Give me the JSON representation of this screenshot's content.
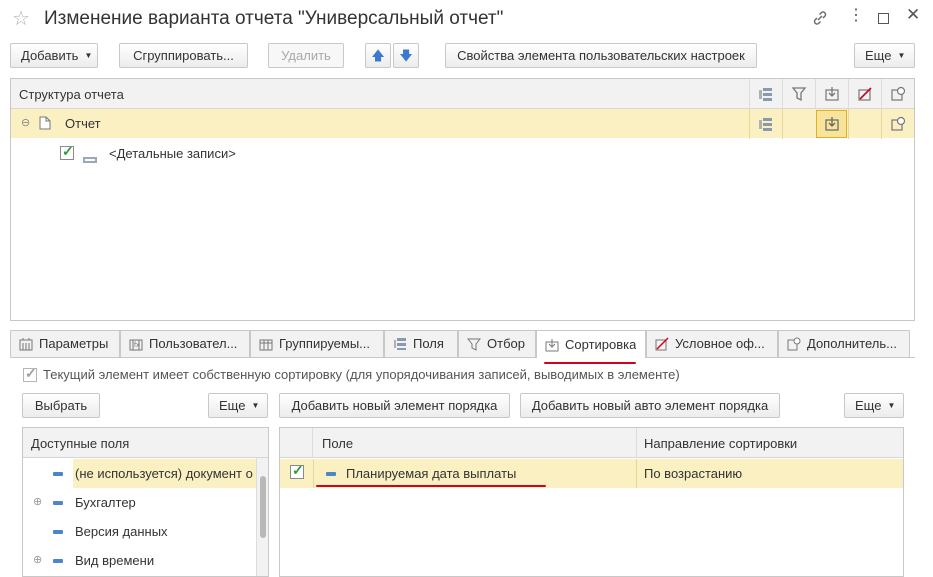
{
  "window": {
    "title": "Изменение варианта отчета \"Универсальный отчет\""
  },
  "toolbar": {
    "add_label": "Добавить",
    "group_label": "Сгруппировать...",
    "delete_label": "Удалить",
    "properties_label": "Свойства элемента пользовательских настроек",
    "more_label": "Еще"
  },
  "structure": {
    "header": "Структура отчета",
    "rows": [
      {
        "label": "Отчет"
      },
      {
        "label": "<Детальные записи>"
      }
    ]
  },
  "tabs": [
    {
      "label": "Параметры",
      "icon": "parameters-icon"
    },
    {
      "label": "Пользовател...",
      "icon": "user-fields-icon"
    },
    {
      "label": "Группируемы...",
      "icon": "grouping-icon"
    },
    {
      "label": "Поля",
      "icon": "fields-icon"
    },
    {
      "label": "Отбор",
      "icon": "filter-icon"
    },
    {
      "label": "Сортировка",
      "icon": "sort-icon"
    },
    {
      "label": "Условное оф...",
      "icon": "conditional-format-icon"
    },
    {
      "label": "Дополнитель...",
      "icon": "extra-settings-icon"
    }
  ],
  "active_tab": "Сортировка",
  "sorting": {
    "own_sort_label": "Текущий элемент имеет собственную сортировку (для  упорядочивания записей, выводимых в элементе)",
    "select_label": "Выбрать",
    "more_left_label": "Еще",
    "add_order_label": "Добавить новый элемент порядка",
    "add_auto_order_label": "Добавить новый авто элемент порядка",
    "more_right_label": "Еще",
    "available": {
      "header": "Доступные поля",
      "items": [
        {
          "label": "(не используется) документ о"
        },
        {
          "label": "Бухгалтер"
        },
        {
          "label": "Версия данных"
        },
        {
          "label": "Вид времени"
        }
      ]
    },
    "order_table": {
      "col_field": "Поле",
      "col_direction": "Направление сортировки",
      "rows": [
        {
          "field": "Планируемая дата выплаты",
          "direction": "По возрастанию"
        }
      ]
    }
  },
  "colors": {
    "accent_yellow": "#fbf0c2",
    "underline_red": "#d0021b",
    "check_green": "#2e9b3a"
  }
}
